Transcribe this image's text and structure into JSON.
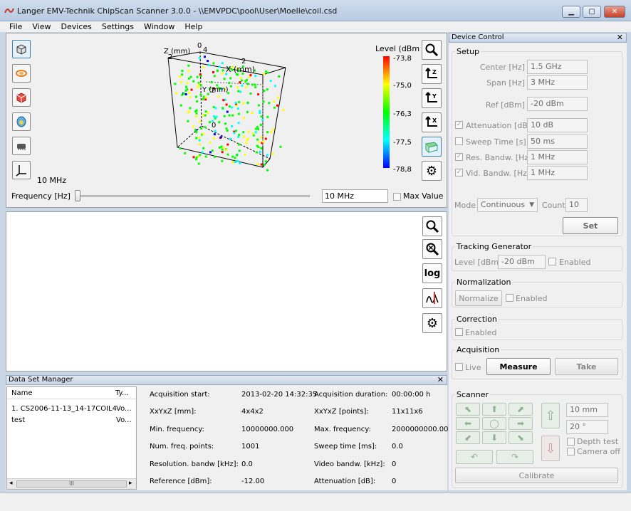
{
  "window": {
    "title": "Langer EMV-Technik ChipScan Scanner 3.0.0  -  \\\\EMVPDC\\pool\\User\\Moelle\\coil.csd"
  },
  "menu": [
    "File",
    "View",
    "Devices",
    "Settings",
    "Window",
    "Help"
  ],
  "plot3d": {
    "axis_z": "Z (mm)",
    "axis_x": "X (mm)",
    "axis_y": "Y (mm)",
    "tick_2a": "2",
    "tick_0a": "0",
    "tick_4": "4",
    "tick_2b": "2",
    "tick_2c": "2",
    "tick_0b": "0",
    "freq_readout": "10 MHz"
  },
  "colorbar": {
    "title": "Level (dBm",
    "ticks": [
      "-73,8",
      "-75,0",
      "-76,3",
      "-77,5",
      "-78,8"
    ],
    "colors": [
      "#ff0000",
      "#ffff00",
      "#00ff00",
      "#00ffff",
      "#0000ff"
    ]
  },
  "frequency": {
    "label": "Frequency [Hz]",
    "value": "10 MHz",
    "max_value_label": "Max Value"
  },
  "plot2d_tools": {
    "log": "log"
  },
  "dsm": {
    "title": "Data Set Manager",
    "col_name": "Name",
    "col_type": "Ty...",
    "rows": [
      {
        "name": "1.  CS2006-11-13_14-17COIL4",
        "type": "Vo..."
      },
      {
        "name": "test",
        "type": "Vo..."
      }
    ],
    "scroll_grip": "III",
    "info": [
      {
        "l1": "Acquisition start:",
        "v1": "2013-02-20 14:32:35",
        "l2": "Acquisition duration:",
        "v2": "00:00:00 h"
      },
      {
        "l1": "XxYxZ [mm]:",
        "v1": "4x4x2",
        "l2": "XxYxZ [points]:",
        "v2": "11x11x6"
      },
      {
        "l1": "Min. frequency:",
        "v1": "10000000.000",
        "l2": "Max. frequency:",
        "v2": "2000000000.000"
      },
      {
        "l1": "Num. freq. points:",
        "v1": "1001",
        "l2": "Sweep time [ms]:",
        "v2": "0.0"
      },
      {
        "l1": "Resolution. bandw [kHz]:",
        "v1": "0.0",
        "l2": "Video bandw. [kHz]:",
        "v2": "0"
      },
      {
        "l1": "Reference [dBm]:",
        "v1": "-12.00",
        "l2": "Attenuation [dB]:",
        "v2": "0"
      }
    ]
  },
  "device_control": {
    "title": "Device Control",
    "setup": {
      "title": "Setup",
      "center_label": "Center [Hz]",
      "center": "1.5 GHz",
      "span_label": "Span [Hz]",
      "span": "3 MHz",
      "ref_label": "Ref [dBm]",
      "ref": "-20 dBm",
      "att_label": "Attenuation [dB]",
      "att": "10 dB",
      "sweep_label": "Sweep Time [s]",
      "sweep": "50 ms",
      "rbw_label": "Res. Bandw. [Hz]",
      "rbw": "1 MHz",
      "vbw_label": "Vid. Bandw. [Hz]",
      "vbw": "1 MHz",
      "mode_label": "Mode",
      "mode": "Continuous",
      "count_label": "Count",
      "count": "10",
      "set": "Set"
    },
    "tracking": {
      "title": "Tracking Generator",
      "level_label": "Level [dBm]",
      "level": "-20 dBm",
      "enabled": "Enabled"
    },
    "normalization": {
      "title": "Normalization",
      "normalize": "Normalize",
      "enabled": "Enabled"
    },
    "correction": {
      "title": "Correction",
      "enabled": "Enabled"
    },
    "acquisition": {
      "title": "Acquisition",
      "live": "Live",
      "measure": "Measure",
      "take": "Take"
    },
    "scanner": {
      "title": "Scanner",
      "step": "10 mm",
      "angle": "20 °",
      "depth": "Depth test",
      "camera": "Camera off",
      "calibrate": "Calibrate"
    }
  }
}
